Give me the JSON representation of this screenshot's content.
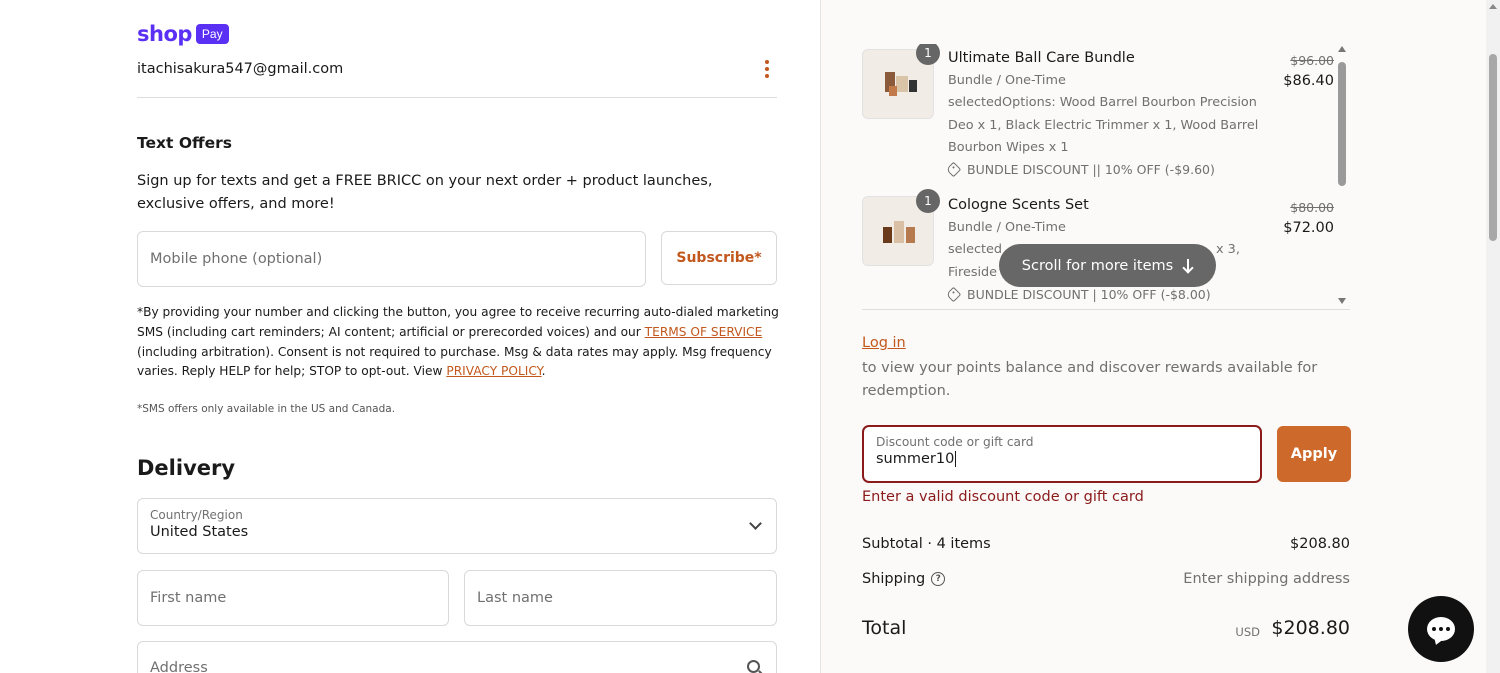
{
  "contact": {
    "logo_word": "shop",
    "logo_badge": "Pay",
    "email": "itachisakura547@gmail.com"
  },
  "text_offers": {
    "heading": "Text Offers",
    "description": "Sign up for texts and get a FREE BRICC on your next order + product launches, exclusive offers, and more!",
    "phone_placeholder": "Mobile phone (optional)",
    "subscribe_label": "Subscribe*",
    "legal_part1": "*By providing your number and clicking the button, you agree to receive recurring auto-dialed marketing SMS (including cart reminders; AI content; artificial or prerecorded voices) and our ",
    "terms_link": "TERMS OF SERVICE",
    "legal_part2": " (including arbitration). Consent is not required to purchase. Msg & data rates may apply. Msg frequency varies. Reply HELP for help; STOP to opt-out. View ",
    "privacy_link": "PRIVACY POLICY",
    "legal_part3": ".",
    "sms_note": "*SMS offers only available in the US and Canada."
  },
  "delivery": {
    "heading": "Delivery",
    "country_label": "Country/Region",
    "country_value": "United States",
    "first_name_placeholder": "First name",
    "last_name_placeholder": "Last name",
    "address_placeholder": "Address"
  },
  "cart": {
    "items": [
      {
        "qty": "1",
        "title": "Ultimate Ball Care Bundle",
        "meta": "Bundle / One-Time",
        "options": "selectedOptions: Wood Barrel Bourbon Precision Deo x 1, Black Electric Trimmer x 1, Wood Barrel Bourbon Wipes x 1",
        "discount": "BUNDLE DISCOUNT || 10% OFF (-$9.60)",
        "old_price": "$96.00",
        "new_price": "$86.40"
      },
      {
        "qty": "1",
        "title": "Cologne Scents Set",
        "meta": "Bundle / One-Time",
        "options_line1_start": "selected",
        "options_line1_end": "x 3,",
        "options_line2": "Fireside",
        "discount": "BUNDLE DISCOUNT | 10% OFF (-$8.00)",
        "old_price": "$80.00",
        "new_price": "$72.00"
      }
    ],
    "scroll_hint": "Scroll for more items"
  },
  "rewards": {
    "login_link": "Log in",
    "description": "to view your points balance and discover rewards available for redemption."
  },
  "discount": {
    "label": "Discount code or gift card",
    "value": "summer10",
    "apply_label": "Apply",
    "error": "Enter a valid discount code or gift card"
  },
  "summary": {
    "subtotal_label": "Subtotal · 4 items",
    "subtotal_value": "$208.80",
    "shipping_label": "Shipping",
    "shipping_value": "Enter shipping address",
    "total_label": "Total",
    "currency": "USD",
    "total_value": "$208.80"
  },
  "icons": {
    "kebab": "kebab-menu-icon",
    "chevron": "chevron-down-icon",
    "search": "search-icon",
    "tag": "tag-icon",
    "help": "help-icon",
    "chat": "chat-icon"
  },
  "colors": {
    "shop_brand": "#5a31f4",
    "accent": "#c2581d",
    "apply_button": "#cd6a2b",
    "error": "#8b1a1a"
  }
}
